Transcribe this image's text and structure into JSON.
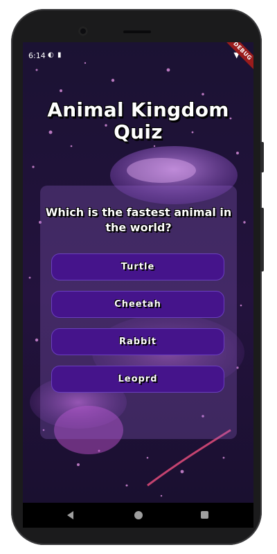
{
  "status_bar": {
    "time": "6:14",
    "debug_banner": "DEBUG"
  },
  "quiz": {
    "title": "Animal Kingdom Quiz",
    "question": "Which is the fastest animal in the world?",
    "answers": [
      "Turtle",
      "Cheetah",
      "Rabbit",
      "Leoprd"
    ]
  },
  "colors": {
    "answer_button": "#45148b",
    "card_overlay": "#9664d2",
    "background": "#190f2c"
  },
  "icons": [
    "signal-status-icon",
    "clipboard-status-icon",
    "wifi-icon",
    "battery-icon",
    "nav-back-icon",
    "nav-home-icon",
    "nav-recents-icon"
  ]
}
